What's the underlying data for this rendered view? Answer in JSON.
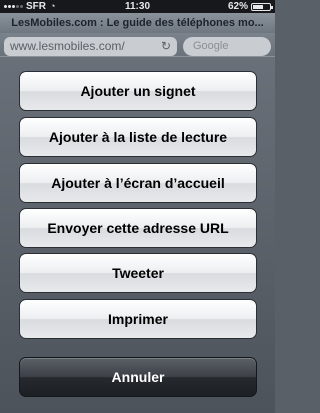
{
  "status_bar": {
    "carrier": "SFR",
    "time": "11:30",
    "battery_percent": "62%",
    "battery_level": 0.62,
    "signal_bars_on": 3,
    "signal_bars_total": 5
  },
  "browser": {
    "page_title": "LesMobiles.com : Le guide des téléphones mo...",
    "url": "www.lesmobiles.com/",
    "search_placeholder": "Google"
  },
  "action_sheet": {
    "buttons": [
      {
        "label": "Ajouter un signet"
      },
      {
        "label": "Ajouter à la liste de lecture"
      },
      {
        "label": "Ajouter à l’écran d’accueil"
      },
      {
        "label": "Envoyer cette adresse URL"
      },
      {
        "label": "Tweeter"
      },
      {
        "label": "Imprimer"
      }
    ],
    "cancel_label": "Annuler"
  }
}
